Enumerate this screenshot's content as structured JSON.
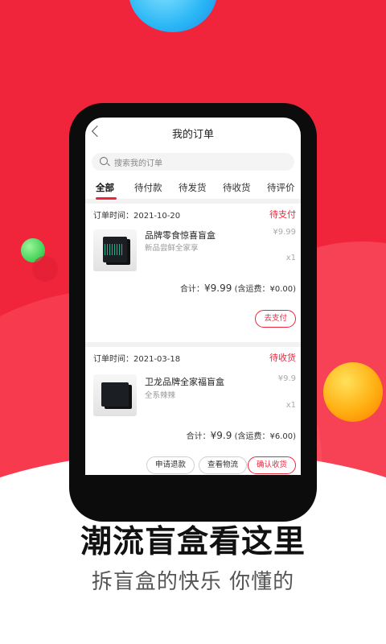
{
  "colors": {
    "accent": "#f0253c",
    "background_red": "#f0253c"
  },
  "nav": {
    "title": "我的订单",
    "back_icon": "chevron-left-icon"
  },
  "search": {
    "placeholder": "搜索我的订单",
    "icon": "search-icon"
  },
  "tabs": [
    {
      "label": "全部",
      "active": true
    },
    {
      "label": "待付款",
      "active": false
    },
    {
      "label": "待发货",
      "active": false
    },
    {
      "label": "待收货",
      "active": false
    },
    {
      "label": "待评价",
      "active": false
    }
  ],
  "orders": [
    {
      "time": "订单时间：2021-10-20",
      "status": "待支付",
      "product_name": "品牌零食惊喜盲盒",
      "product_sub": "新品尝鲜全家享",
      "price": "¥9.99",
      "qty": "x1",
      "total_prefix": "合计：",
      "total_amount": "¥9.99",
      "total_suffix": "(含运费：¥0.00)",
      "buttons": [
        "去支付"
      ]
    },
    {
      "time": "订单时间：2021-03-18",
      "status": "待收货",
      "product_name": "卫龙品牌全家福盲盒",
      "product_sub": "全系辣辣",
      "price": "¥9.9",
      "qty": "x1",
      "total_prefix": "合计：",
      "total_amount": "¥9.9",
      "total_suffix": "(含运费：¥6.00)",
      "buttons": [
        "申请退款",
        "查看物流",
        "确认收货"
      ]
    }
  ],
  "promo": {
    "headline": "潮流盲盒看这里",
    "subline": "拆盲盒的快乐 你懂的"
  }
}
